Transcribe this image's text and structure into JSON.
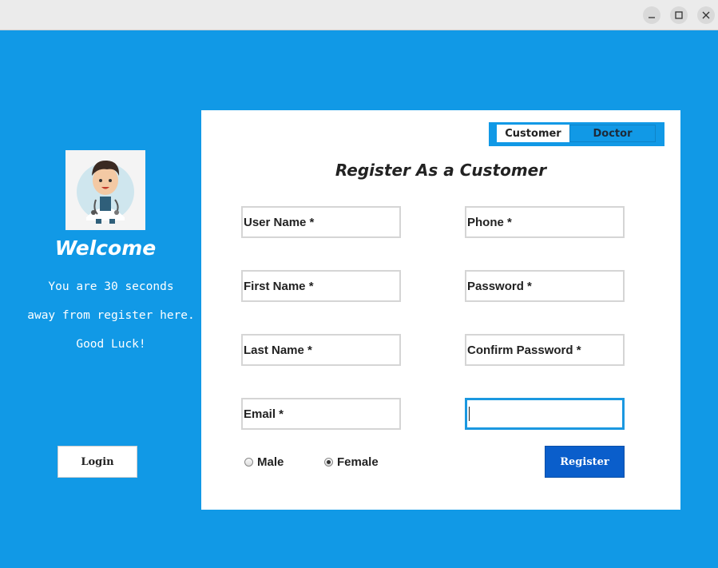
{
  "window": {
    "buttons": [
      "minimize",
      "maximize",
      "close"
    ]
  },
  "sidebar": {
    "welcome": "Welcome",
    "message_lines": [
      "You are 30 seconds",
      "away from register here.",
      "Good Luck!"
    ],
    "login_label": "Login"
  },
  "form": {
    "tabs": {
      "customer": "Customer",
      "doctor": "Doctor"
    },
    "heading": "Register As a Customer",
    "fields": {
      "username": "User Name *",
      "phone": "Phone *",
      "first_name": "First Name *",
      "password": "Password *",
      "last_name": "Last Name *",
      "confirm_password": "Confirm Password *",
      "email": "Email *",
      "extra": ""
    },
    "gender": {
      "male": "Male",
      "female": "Female",
      "selected": "Female"
    },
    "register_label": "Register"
  },
  "colors": {
    "background": "#1199e6",
    "register_button": "#0a5ecb",
    "active_field_border": "#1b98e0"
  }
}
